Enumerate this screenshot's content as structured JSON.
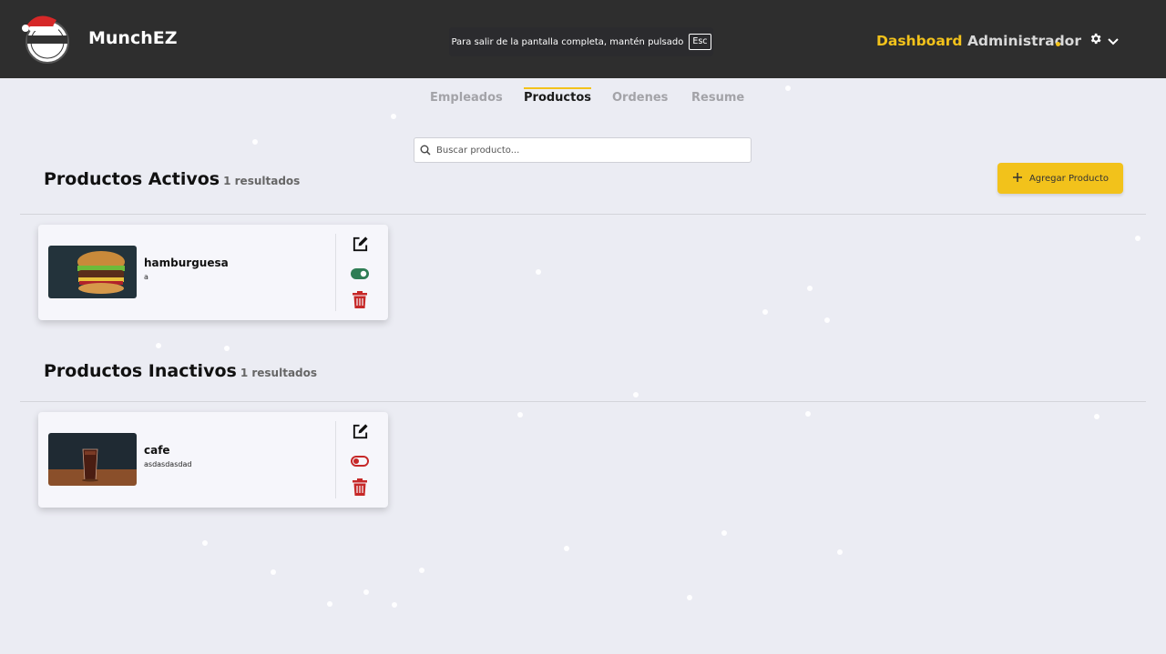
{
  "header": {
    "brand": "MunchEZ",
    "logo_text": "MUNCHEZ",
    "fullscreen_notice": "Para salir de la pantalla completa, mantén pulsado",
    "fullscreen_key": "Esc",
    "dashboard_word": "Dashboard",
    "role_word": "Administrador",
    "accent_color": "#f2c21b",
    "settings_icon": "gear-icon",
    "dropdown_icon": "chevron-down-icon"
  },
  "tabs": [
    {
      "label": "Empleados",
      "active": false
    },
    {
      "label": "Productos",
      "active": true
    },
    {
      "label": "Ordenes",
      "active": false
    },
    {
      "label": "Resume",
      "active": false
    }
  ],
  "search": {
    "placeholder": "Buscar producto..."
  },
  "active_section": {
    "title": "Productos Activos",
    "count": "1 resultados",
    "add_button": "Agregar Producto",
    "products": [
      {
        "name": "hamburguesa",
        "description": "a",
        "enabled": true,
        "image": "burger-photo"
      }
    ]
  },
  "inactive_section": {
    "title": "Productos Inactivos",
    "count": "1 resultados",
    "products": [
      {
        "name": "cafe",
        "description": "asdasdasdad",
        "enabled": false,
        "image": "drink-photo"
      }
    ]
  },
  "colors": {
    "toggle_on": "#2e7d55",
    "toggle_off": "#c62828",
    "delete": "#c62828"
  }
}
